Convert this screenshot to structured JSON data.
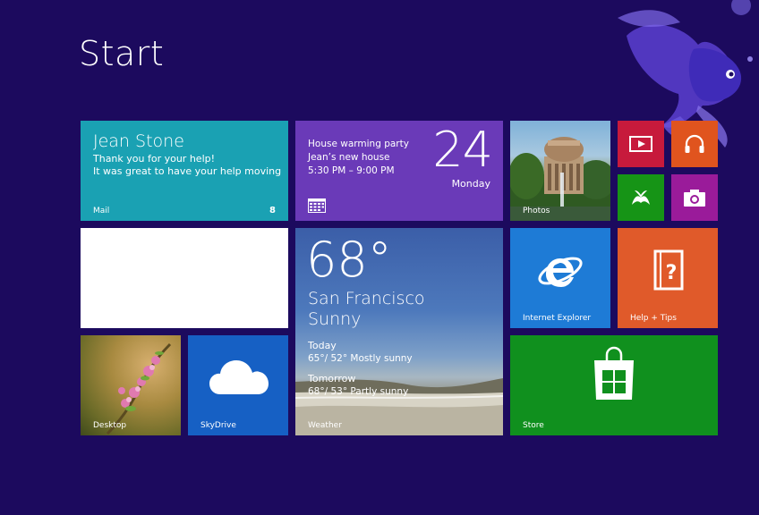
{
  "screen": {
    "title": "Start"
  },
  "colors": {
    "background": "#1c0a5e"
  },
  "tiles": {
    "mail": {
      "label": "Mail",
      "sender": "Jean Stone",
      "line1": "Thank you for your help!",
      "line2": "It was great to have your help moving",
      "count": "8",
      "color": "#1aa1b3"
    },
    "calendar": {
      "line1": "House warming party",
      "line2": "Jean’s new house",
      "line3": "5:30 PM – 9:00 PM",
      "day": "24",
      "weekday": "Monday",
      "color": "#6a3ab8"
    },
    "photos": {
      "label": "Photos"
    },
    "video": {
      "icon": "video-icon",
      "color": "#c71a3c"
    },
    "music": {
      "icon": "headphones-icon",
      "color": "#e0541e"
    },
    "games": {
      "icon": "xbox-icon",
      "color": "#169416"
    },
    "camera": {
      "icon": "camera-icon",
      "color": "#9a1b9a"
    },
    "weather": {
      "label": "Weather",
      "temp": "68°",
      "city": "San Francisco",
      "condition": "Sunny",
      "today_label": "Today",
      "today_forecast": "65°/ 52° Mostly sunny",
      "tomorrow_label": "Tomorrow",
      "tomorrow_forecast": "68°/ 53° Partly sunny"
    },
    "ie": {
      "label": "Internet Explorer",
      "color": "#1e7bd6"
    },
    "help": {
      "label": "Help + Tips",
      "color": "#e05a2a"
    },
    "desktop": {
      "label": "Desktop"
    },
    "skydrive": {
      "label": "SkyDrive",
      "color": "#1660c4"
    },
    "store": {
      "label": "Store",
      "color": "#10901e"
    }
  }
}
